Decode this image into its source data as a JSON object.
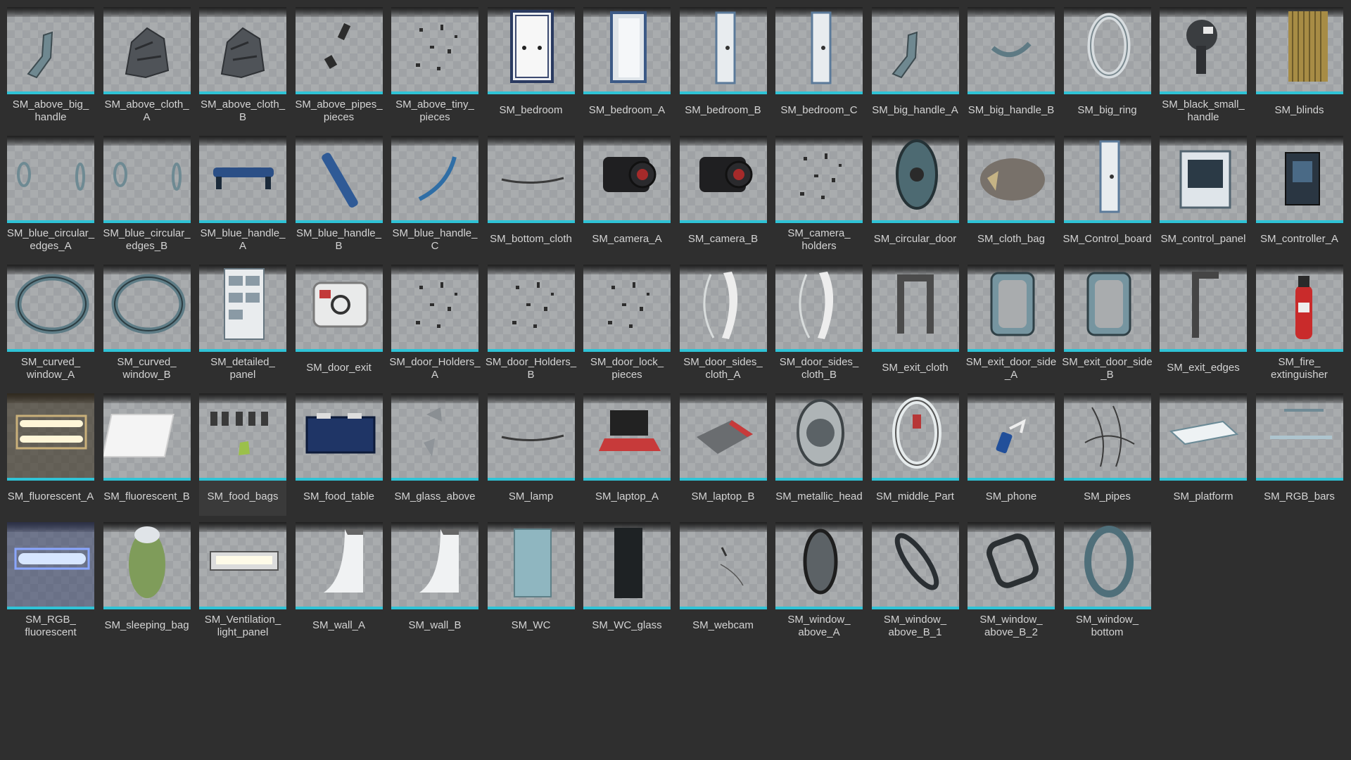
{
  "accent_color": "#2fc3d6",
  "selected_index": 44,
  "assets": [
    {
      "label": "SM_above_big_\nhandle",
      "icon": "bracket"
    },
    {
      "label": "SM_above_cloth_\nA",
      "icon": "cloth-pile"
    },
    {
      "label": "SM_above_cloth_\nB",
      "icon": "cloth-pile"
    },
    {
      "label": "SM_above_pipes_\npieces",
      "icon": "small-pieces"
    },
    {
      "label": "SM_above_tiny_\npieces",
      "icon": "tiny-pieces"
    },
    {
      "label": "SM_bedroom",
      "icon": "cabinet"
    },
    {
      "label": "SM_bedroom_A",
      "icon": "door-frame"
    },
    {
      "label": "SM_bedroom_B",
      "icon": "panel-door"
    },
    {
      "label": "SM_bedroom_C",
      "icon": "panel-door"
    },
    {
      "label": "SM_big_handle_A",
      "icon": "bracket"
    },
    {
      "label": "SM_big_handle_B",
      "icon": "curved-handle"
    },
    {
      "label": "SM_big_ring",
      "icon": "ring"
    },
    {
      "label": "SM_black_small_\nhandle",
      "icon": "knob"
    },
    {
      "label": "SM_blinds",
      "icon": "blinds"
    },
    {
      "label": "SM_blue_circular_\nedges_A",
      "icon": "ring-pair"
    },
    {
      "label": "SM_blue_circular_\nedges_B",
      "icon": "ring-pair"
    },
    {
      "label": "SM_blue_handle_\nA",
      "icon": "blue-bar"
    },
    {
      "label": "SM_blue_handle_\nB",
      "icon": "blue-bar-diag"
    },
    {
      "label": "SM_blue_handle_\nC",
      "icon": "blue-curve"
    },
    {
      "label": "SM_bottom_cloth",
      "icon": "flat-line"
    },
    {
      "label": "SM_camera_A",
      "icon": "camera"
    },
    {
      "label": "SM_camera_B",
      "icon": "camera"
    },
    {
      "label": "SM_camera_\nholders",
      "icon": "tiny-pieces"
    },
    {
      "label": "SM_circular_door",
      "icon": "round-door"
    },
    {
      "label": "SM_cloth_bag",
      "icon": "bag"
    },
    {
      "label": "SM_Control_board",
      "icon": "panel-door"
    },
    {
      "label": "SM_control_panel",
      "icon": "control-panel"
    },
    {
      "label": "SM_controller_A",
      "icon": "controller"
    },
    {
      "label": "SM_curved_\nwindow_A",
      "icon": "big-ring"
    },
    {
      "label": "SM_curved_\nwindow_B",
      "icon": "big-ring"
    },
    {
      "label": "SM_detailed_\npanel",
      "icon": "shelf"
    },
    {
      "label": "SM_door_exit",
      "icon": "safe-door"
    },
    {
      "label": "SM_door_Holders_\nA",
      "icon": "tiny-pieces"
    },
    {
      "label": "SM_door_Holders_\nB",
      "icon": "tiny-pieces"
    },
    {
      "label": "SM_door_lock_\npieces",
      "icon": "tiny-pieces"
    },
    {
      "label": "SM_door_sides_\ncloth_A",
      "icon": "arc-cloth"
    },
    {
      "label": "SM_door_sides_\ncloth_B",
      "icon": "arc-cloth"
    },
    {
      "label": "SM_exit_cloth",
      "icon": "exit-frame"
    },
    {
      "label": "SM_exit_door_side\n_A",
      "icon": "frame-rect"
    },
    {
      "label": "SM_exit_door_side\n_B",
      "icon": "frame-rect"
    },
    {
      "label": "SM_exit_edges",
      "icon": "exit-edge"
    },
    {
      "label": "SM_fire_\nextinguisher",
      "icon": "extinguisher"
    },
    {
      "label": "SM_fluorescent_A",
      "icon": "light-double"
    },
    {
      "label": "SM_fluorescent_B",
      "icon": "light-white"
    },
    {
      "label": "SM_food_bags",
      "icon": "food-bags"
    },
    {
      "label": "SM_food_table",
      "icon": "food-table"
    },
    {
      "label": "SM_glass_above",
      "icon": "glass-shards"
    },
    {
      "label": "SM_lamp",
      "icon": "flat-line"
    },
    {
      "label": "SM_laptop_A",
      "icon": "laptop"
    },
    {
      "label": "SM_laptop_B",
      "icon": "laptop-closed"
    },
    {
      "label": "SM_metallic_head",
      "icon": "head"
    },
    {
      "label": "SM_middle_Part",
      "icon": "middle-ring"
    },
    {
      "label": "SM_phone",
      "icon": "phone"
    },
    {
      "label": "SM_pipes",
      "icon": "pipes"
    },
    {
      "label": "SM_platform",
      "icon": "platform"
    },
    {
      "label": "SM_RGB_bars",
      "icon": "bars"
    },
    {
      "label": "SM_RGB_\nfluorescent",
      "icon": "light-blue"
    },
    {
      "label": "SM_sleeping_bag",
      "icon": "sleeping-bag"
    },
    {
      "label": "SM_Ventilation_\nlight_panel",
      "icon": "vent-light"
    },
    {
      "label": "SM_wall_A",
      "icon": "wall-curve"
    },
    {
      "label": "SM_wall_B",
      "icon": "wall-curve"
    },
    {
      "label": "SM_WC",
      "icon": "wc-box"
    },
    {
      "label": "SM_WC_glass",
      "icon": "wc-glass"
    },
    {
      "label": "SM_webcam",
      "icon": "webcam"
    },
    {
      "label": "SM_window_\nabove_A",
      "icon": "oval-window"
    },
    {
      "label": "SM_window_\nabove_B_1",
      "icon": "oval-tilt"
    },
    {
      "label": "SM_window_\nabove_B_2",
      "icon": "square-ring"
    },
    {
      "label": "SM_window_\nbottom",
      "icon": "window-ring"
    }
  ]
}
